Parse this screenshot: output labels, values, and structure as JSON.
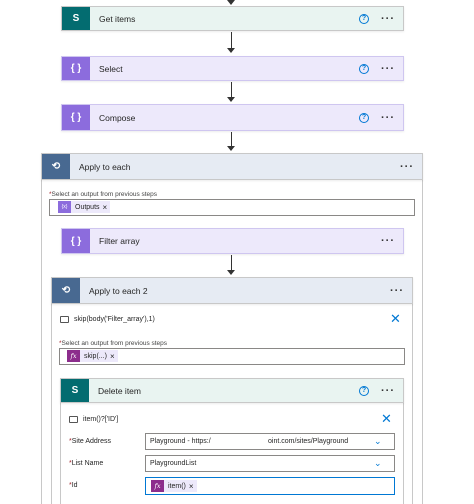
{
  "steps": {
    "get_items": {
      "title": "Get items",
      "help": "?",
      "more": "···"
    },
    "select": {
      "title": "Select",
      "help": "?",
      "more": "···"
    },
    "compose": {
      "title": "Compose",
      "help": "?",
      "more": "···"
    }
  },
  "apply_each": {
    "title": "Apply to each",
    "more": "···",
    "label_req": "*",
    "label": "Select an output from previous steps",
    "token_icon": "{x}",
    "token_text": "Outputs",
    "token_close": "×",
    "filter": {
      "title": "Filter array",
      "more": "···"
    },
    "apply_each_2": {
      "title": "Apply to each 2",
      "more": "···",
      "expression": "skip(body('Filter_array'),1)",
      "close": "✕",
      "label_req": "*",
      "label": "Select an output from previous steps",
      "token_icon": "fx",
      "token_text": "skip(...)",
      "token_close": "×",
      "delete_item": {
        "title": "Delete item",
        "help": "?",
        "more": "···",
        "expression": "item()?['ID']",
        "close": "✕",
        "site_label": "Site Address",
        "site_value": "Playground - https:/",
        "site_value_right": "oint.com/sites/Playground",
        "list_label": "List Name",
        "list_value": "PlaygroundList",
        "id_label": "Id",
        "id_token_icon": "fx",
        "id_token_text": "item()",
        "id_token_close": "×",
        "req": "*"
      }
    }
  },
  "colors": {
    "sharepoint": "#036c70",
    "data_operation": "#8c6cdd",
    "control": "#486991",
    "accent": "#0078d4"
  },
  "icons": {
    "sharepoint": "sharepoint-icon",
    "data_operation": "curly-braces-icon",
    "loop": "loop-icon",
    "expression": "fx-icon"
  }
}
